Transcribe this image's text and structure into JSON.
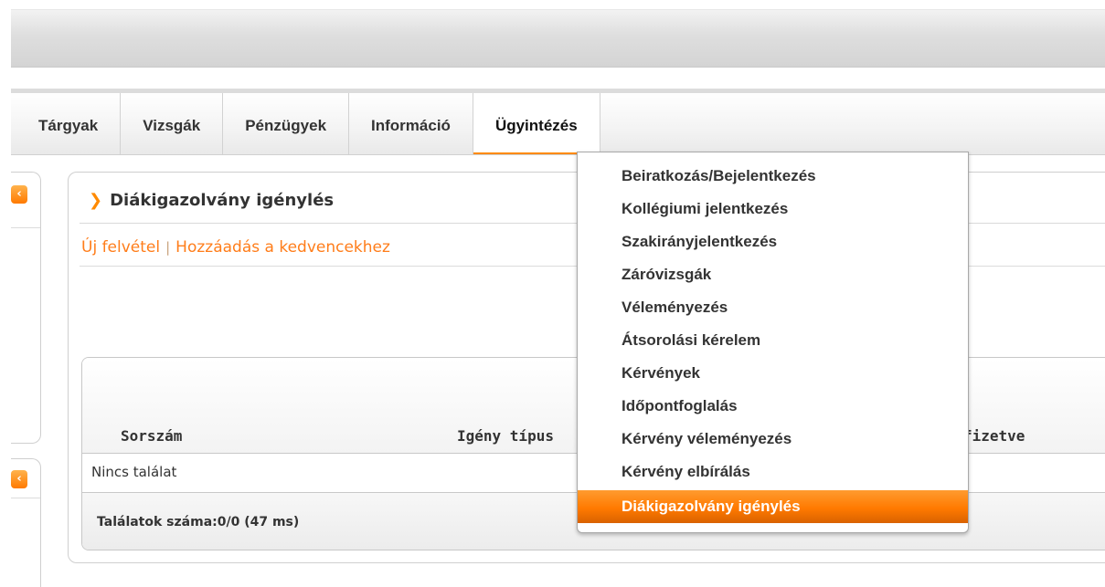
{
  "nav": {
    "items": [
      {
        "label": "Tárgyak"
      },
      {
        "label": "Vizsgák"
      },
      {
        "label": "Pénzügyek"
      },
      {
        "label": "Információ"
      },
      {
        "label": "Ügyintézés"
      }
    ],
    "active": "Ügyintézés"
  },
  "sidebar": {
    "collapse_glyph": "‹"
  },
  "main": {
    "title": "Diákigazolvány igénylés",
    "links": {
      "new_record": "Új felvétel",
      "separator": "|",
      "add_favorite": "Hozzáadás a kedvencekhez"
    },
    "table": {
      "columns": [
        "Sorszám",
        "Igény típus",
        "fizetve"
      ],
      "empty_text": "Nincs találat",
      "footer": "Találatok száma:0/0 (47 ms)"
    }
  },
  "dropdown": {
    "items": [
      "Beiratkozás/Bejelentkezés",
      "Kollégiumi jelentkezés",
      "Szakirányjelentkezés",
      "Záróvizsgák",
      "Véleményezés",
      "Átsorolási kérelem",
      "Kérvények",
      "Időpontfoglalás",
      "Kérvény véleményezés",
      "Kérvény elbírálás",
      "Diákigazolvány igénylés"
    ],
    "highlighted": "Diákigazolvány igénylés"
  },
  "colors": {
    "accent": "#ff7a00",
    "link": "#ff7d1a"
  }
}
